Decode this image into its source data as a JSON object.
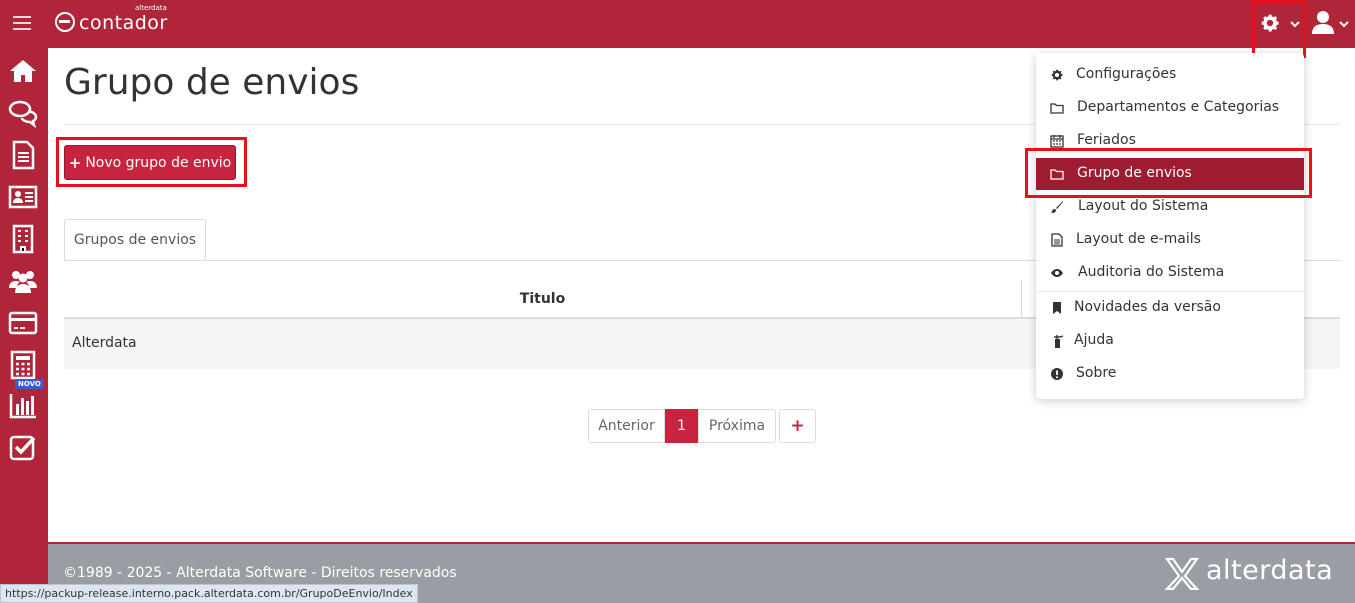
{
  "header": {
    "logo_text": "contador",
    "logo_small": "alterdata",
    "settings_icon": "gear-icon",
    "user_icon": "user-icon"
  },
  "sidebar": {
    "items": [
      {
        "icon": "home-icon"
      },
      {
        "icon": "chat-icon"
      },
      {
        "icon": "document-icon"
      },
      {
        "icon": "id-card-icon"
      },
      {
        "icon": "building-icon"
      },
      {
        "icon": "users-icon"
      },
      {
        "icon": "credit-card-icon"
      },
      {
        "icon": "calculator-icon"
      },
      {
        "icon": "bar-chart-icon",
        "badge": "NOVO"
      },
      {
        "icon": "checkbox-icon"
      }
    ]
  },
  "main": {
    "title": "Grupo de envios",
    "new_button": "Novo grupo de envio",
    "tab": "Grupos de envios",
    "table": {
      "header": "Titulo",
      "rows": [
        "Alterdata"
      ]
    },
    "pager": {
      "prev": "Anterior",
      "page": "1",
      "next": "Próxima",
      "add": "+"
    }
  },
  "menu": {
    "items": [
      {
        "label": "Configurações",
        "icon": "gear-icon"
      },
      {
        "label": "Departamentos e Categorias",
        "icon": "folder-icon"
      },
      {
        "label": "Feriados",
        "icon": "calendar-icon"
      },
      {
        "label": "Grupo de envios",
        "icon": "folder-icon",
        "active": true
      },
      {
        "label": "Layout do Sistema",
        "icon": "brush-icon"
      },
      {
        "label": "Layout de e-mails",
        "icon": "file-icon"
      },
      {
        "label": "Auditoria do Sistema",
        "icon": "eye-icon"
      },
      {
        "label": "Novidades da versão",
        "icon": "bookmark-icon"
      },
      {
        "label": "Ajuda",
        "icon": "extinguisher-icon"
      },
      {
        "label": "Sobre",
        "icon": "info-icon"
      }
    ]
  },
  "footer": {
    "copyright": "©1989 - 2025 - Alterdata Software - Direitos reservados",
    "logo_text": "alterdata"
  },
  "status_bar": {
    "url": "https://packup-release.interno.pack.alterdata.com.br/GrupoDeEnvio/Index"
  },
  "colors": {
    "brand": "#b0253a",
    "button": "#c8243f",
    "menu_active": "#9d1c30",
    "footer": "#9a9ea4",
    "highlight": "#e8101c"
  }
}
